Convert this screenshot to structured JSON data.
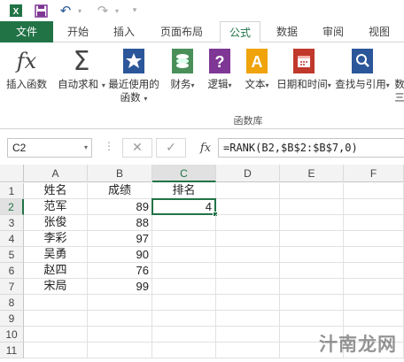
{
  "quick_access": {
    "icons": [
      "excel-icon",
      "save-icon",
      "undo-icon",
      "redo-icon",
      "customize-icon"
    ]
  },
  "ribbon_tabs": [
    "文件",
    "开始",
    "插入",
    "页面布局",
    "公式",
    "数据",
    "审阅",
    "视图"
  ],
  "active_tab": "公式",
  "ribbon": {
    "insert_function": "插入函数",
    "autosum": "自动求和",
    "recent": "最近使用的",
    "recent_line2": "函数",
    "financial": "财务",
    "logical": "逻辑",
    "text": "文本",
    "datetime": "日期和时间",
    "lookup": "查找与引用",
    "more_line1": "数",
    "more_line2": "三",
    "group_label": "函数库"
  },
  "formula_bar": {
    "name_box": "C2",
    "fx_label": "fx",
    "cancel_symbol": "✕",
    "enter_symbol": "✓",
    "formula": "=RANK(B2,$B$2:$B$7,0)"
  },
  "sheet": {
    "columns": [
      "A",
      "B",
      "C",
      "D",
      "E",
      "F"
    ],
    "rows": [
      "1",
      "2",
      "3",
      "4",
      "5",
      "6",
      "7",
      "8",
      "9",
      "10",
      "11"
    ],
    "selected_cell": "C2",
    "cells": {
      "A1": "姓名",
      "B1": "成绩",
      "C1": "排名",
      "A2": "范军",
      "B2": "89",
      "C2": "4",
      "A3": "张俊",
      "B3": "88",
      "A4": "李彩",
      "B4": "97",
      "A5": "吴勇",
      "B5": "90",
      "A6": "赵四",
      "B6": "76",
      "A7": "宋局",
      "B7": "99"
    }
  },
  "watermark": "汁南龙网",
  "colors": {
    "accent": "#217346",
    "icon_blue": "#2b579a",
    "icon_purple": "#7e3794",
    "icon_orange": "#f0a30a",
    "icon_red": "#c0392b"
  }
}
